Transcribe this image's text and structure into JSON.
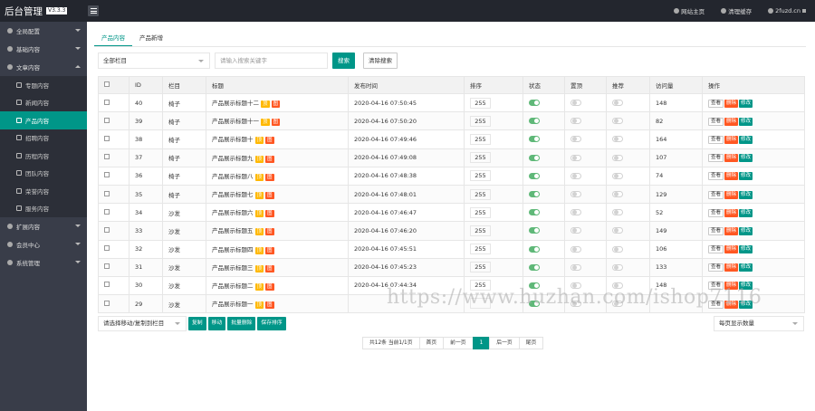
{
  "brand": {
    "title": "后台管理",
    "version": "V3.3.3"
  },
  "topbar": {
    "links": [
      "网站主页",
      "清理缓存",
      "2fuzd.cn"
    ]
  },
  "sidebar": {
    "groups_top": [
      {
        "label": "全局配置"
      },
      {
        "label": "基础内容"
      },
      {
        "label": "文章内容"
      }
    ],
    "sub_items": [
      {
        "label": "专题内容"
      },
      {
        "label": "新闻内容"
      },
      {
        "label": "产品内容"
      },
      {
        "label": "招聘内容"
      },
      {
        "label": "历程内容"
      },
      {
        "label": "团队内容"
      },
      {
        "label": "荣誉内容"
      },
      {
        "label": "服务内容"
      }
    ],
    "groups_bottom": [
      {
        "label": "扩展内容"
      },
      {
        "label": "会员中心"
      },
      {
        "label": "系统管理"
      }
    ]
  },
  "tabs": [
    {
      "label": "产品内容"
    },
    {
      "label": "产品新增"
    }
  ],
  "filter": {
    "column_select": "全部栏目",
    "keyword_placeholder": "请输入搜索关键字",
    "search_label": "搜索",
    "clear_label": "清除搜索"
  },
  "table": {
    "headers": [
      "",
      "ID",
      "栏目",
      "标题",
      "发布时间",
      "排序",
      "状态",
      "置顶",
      "推荐",
      "访问量",
      "操作"
    ],
    "tag_top": "顶",
    "tag_img": "图",
    "ops": {
      "view": "查看",
      "delete": "删除",
      "edit": "修改"
    },
    "rows": [
      {
        "id": "40",
        "col": "椅子",
        "title": "产品展示标题十二",
        "time": "2020-04-16 07:50:45",
        "sort": "255",
        "views": "148"
      },
      {
        "id": "39",
        "col": "椅子",
        "title": "产品展示标题十一",
        "time": "2020-04-16 07:50:20",
        "sort": "255",
        "views": "82"
      },
      {
        "id": "38",
        "col": "椅子",
        "title": "产品展示标题十",
        "time": "2020-04-16 07:49:46",
        "sort": "255",
        "views": "164"
      },
      {
        "id": "37",
        "col": "椅子",
        "title": "产品展示标题九",
        "time": "2020-04-16 07:49:08",
        "sort": "255",
        "views": "107"
      },
      {
        "id": "36",
        "col": "椅子",
        "title": "产品展示标题八",
        "time": "2020-04-16 07:48:38",
        "sort": "255",
        "views": "74"
      },
      {
        "id": "35",
        "col": "椅子",
        "title": "产品展示标题七",
        "time": "2020-04-16 07:48:01",
        "sort": "255",
        "views": "129"
      },
      {
        "id": "34",
        "col": "沙发",
        "title": "产品展示标题六",
        "time": "2020-04-16 07:46:47",
        "sort": "255",
        "views": "52"
      },
      {
        "id": "33",
        "col": "沙发",
        "title": "产品展示标题五",
        "time": "2020-04-16 07:46:20",
        "sort": "255",
        "views": "149"
      },
      {
        "id": "32",
        "col": "沙发",
        "title": "产品展示标题四",
        "time": "2020-04-16 07:45:51",
        "sort": "255",
        "views": "106"
      },
      {
        "id": "31",
        "col": "沙发",
        "title": "产品展示标题三",
        "time": "2020-04-16 07:45:23",
        "sort": "255",
        "views": "133"
      },
      {
        "id": "30",
        "col": "沙发",
        "title": "产品展示标题二",
        "time": "2020-04-16 07:44:34",
        "sort": "255",
        "views": "148"
      },
      {
        "id": "29",
        "col": "沙发",
        "title": "产品展示标题一",
        "time": "",
        "sort": "",
        "views": ""
      }
    ]
  },
  "bottom": {
    "move_select": "请选择移动/复制到栏目",
    "buttons": [
      "复制",
      "移动",
      "批量删除",
      "保存排序"
    ],
    "page_size": "每页显示数量"
  },
  "pager": {
    "summary": "共12条 当前1/1页",
    "first": "首页",
    "prev": "前一页",
    "current": "1",
    "next": "后一页",
    "last": "尾页"
  },
  "watermark": "https://www.huzhan.com/ishop7116",
  "colors": {
    "accent": "#009688",
    "danger": "#ff5722",
    "warn": "#ffb800",
    "switch_on": "#5fb878",
    "topbar": "#23262e",
    "sidebar": "#393d49"
  }
}
